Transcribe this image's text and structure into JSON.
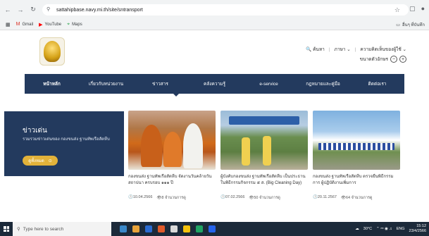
{
  "browser": {
    "url": "sattahipbase.navy.mi.th/site/sntransport",
    "bookmarks": [
      {
        "icon": "gmail-icon",
        "label": "Gmail"
      },
      {
        "icon": "youtube-icon",
        "label": "YouTube"
      },
      {
        "icon": "maps-icon",
        "label": "Maps"
      }
    ],
    "bookmarks_right": "อื่นๆ ที่บันทึก"
  },
  "header": {
    "search_label": "ค้นหา",
    "language_label": "ภาษา",
    "text_size_label": "ความคิดเห็นของผู้ใช้",
    "font_size_label": "ขนาดตัวอักษร"
  },
  "nav": {
    "items": [
      "หน้าหลัก",
      "เกี่ยวกับหน่วยงาน",
      "ข่าวสาร",
      "คลังความรู้",
      "e-service",
      "กฎหมายและคู่มือ",
      "ติดต่อเรา"
    ],
    "active_index": 0
  },
  "news": {
    "title": "ข่าวเด่น",
    "description": "รวมรวมข่าวเด่นของ กองขนส่ง ฐานทัพเรือสัตหีบ",
    "more_label": "ดูทั้งหมด",
    "cards": [
      {
        "caption": "กองขนส่ง ฐานทัพเรือสัตหีบ จัดงานวันคล้ายวันสถาปนา ครบรอบ ๑๑๑ ปี",
        "date": "10.04.2566",
        "views": "8 จำนวนการดู"
      },
      {
        "caption": "ผู้บังคับกองขนส่ง ฐานทัพเรือสัตหีบ เป็นประธานในพิธีกรรมกิจกรรม ๕ ส. (Big Cleaning Day)",
        "date": "07.02.2566",
        "views": "50 จำนวนการดู"
      },
      {
        "caption": "กองขนส่ง ฐานทัพเรือสัตหีบ ตรวจยืนพิธีกรรมการ ผู้ปฏิบัติงานเพิ่มการ",
        "date": "20.11.2567",
        "views": "64 จำนวนการดู"
      }
    ]
  },
  "taskbar": {
    "search_placeholder": "Type here to search",
    "weather": "30°C",
    "lang": "ENG",
    "time": "15:12",
    "date": "23/4/2566"
  },
  "colors": {
    "navy": "#233a5e",
    "gold": "#e2b23a"
  }
}
